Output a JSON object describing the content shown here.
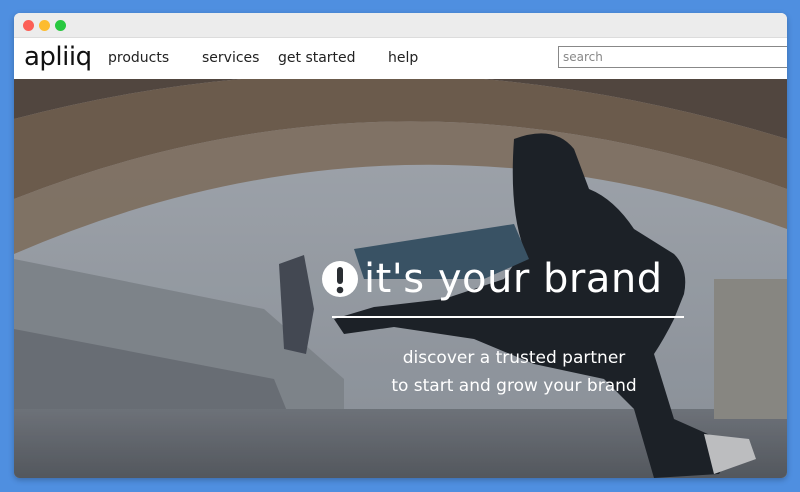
{
  "window": {
    "controls": [
      "close",
      "minimize",
      "maximize"
    ]
  },
  "navbar": {
    "logo": "apliiq",
    "items": [
      {
        "label": "products"
      },
      {
        "label": "services"
      },
      {
        "label": "get started"
      },
      {
        "label": "help"
      }
    ],
    "search": {
      "placeholder": "search",
      "value": ""
    }
  },
  "hero": {
    "icon": "exclamation-circle-icon",
    "headline": "it's your brand",
    "tagline_line1": "discover a trusted partner",
    "tagline_line2": "to start and grow your brand"
  },
  "colors": {
    "page_background": "#4f8fe0",
    "text_on_hero": "#ffffff"
  }
}
